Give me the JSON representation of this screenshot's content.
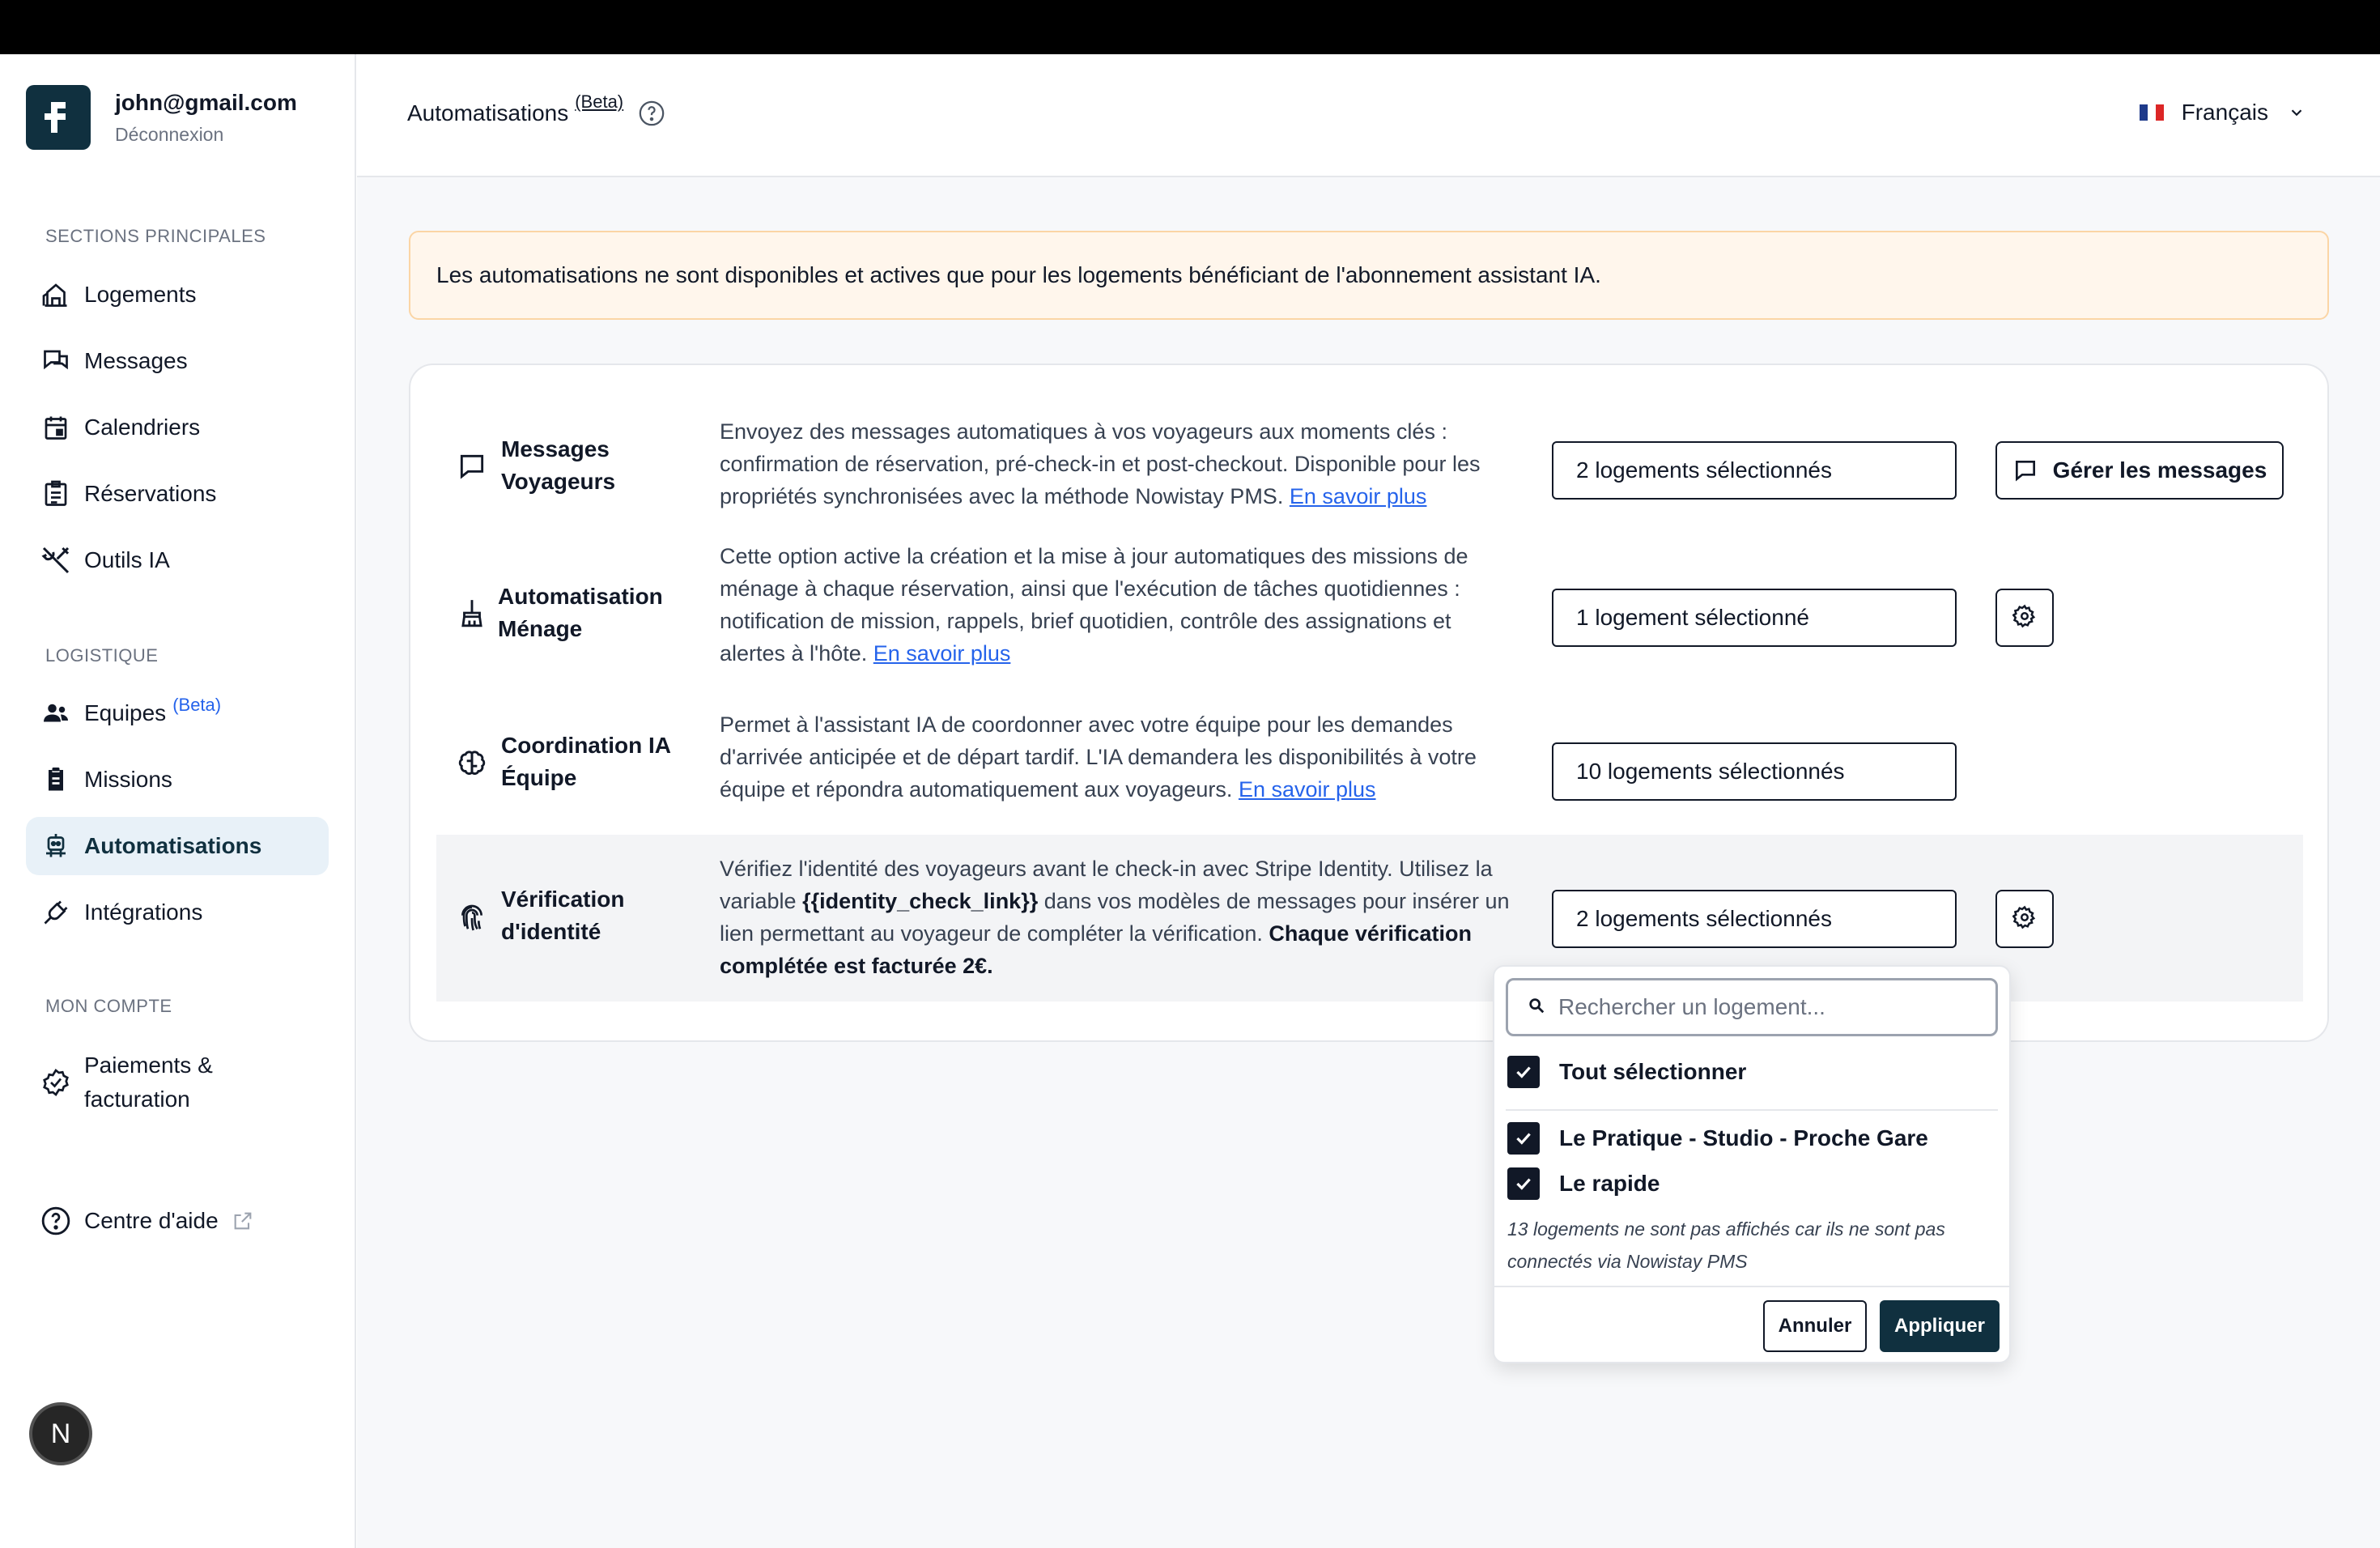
{
  "profile": {
    "email": "john@gmail.com",
    "logout_label": "Déconnexion",
    "logo_icon": "nowistay-logo-icon"
  },
  "sidebar": {
    "sections": [
      {
        "label": "SECTIONS PRINCIPALES",
        "items": [
          {
            "label": "Logements",
            "icon": "building-icon"
          },
          {
            "label": "Messages",
            "icon": "chat-bubbles-icon"
          },
          {
            "label": "Calendriers",
            "icon": "calendar-icon"
          },
          {
            "label": "Réservations",
            "icon": "clipboard-list-icon"
          },
          {
            "label": "Outils IA",
            "icon": "tools-icon"
          }
        ]
      },
      {
        "label": "LOGISTIQUE",
        "items": [
          {
            "label": "Equipes",
            "badge": "(Beta)",
            "icon": "team-icon"
          },
          {
            "label": "Missions",
            "icon": "clipboard-icon"
          },
          {
            "label": "Automatisations",
            "icon": "robot-icon",
            "active": true
          },
          {
            "label": "Intégrations",
            "icon": "plug-icon"
          }
        ]
      },
      {
        "label": "MON COMPTE",
        "items": [
          {
            "label": "Paiements & facturation",
            "icon": "badge-check-icon"
          },
          {
            "label": "Centre d'aide",
            "icon": "help-circle-icon",
            "external": true
          }
        ]
      }
    ],
    "bottom_badge": "N"
  },
  "header": {
    "title": "Automatisations",
    "title_badge": "(Beta)",
    "language": "Français"
  },
  "alert": {
    "text": "Les automatisations ne sont disponibles et actives que pour les logements bénéficiant de l'abonnement assistant IA."
  },
  "automations": [
    {
      "title": "Messages Voyageurs",
      "icon": "message-square-icon",
      "description": "Envoyez des messages automatiques à vos voyageurs aux moments clés : confirmation de réservation, pré-check-in et post-checkout. Disponible pour les propriétés synchronisées avec la méthode Nowistay PMS.",
      "link": "En savoir plus",
      "selection": "2 logements sélectionnés",
      "action_label": "Gérer les messages"
    },
    {
      "title": "Automatisation Ménage",
      "icon": "broom-icon",
      "description": "Cette option active la création et la mise à jour automatiques des missions de ménage à chaque réservation, ainsi que l'exécution de tâches quotidiennes : notification de mission, rappels, brief quotidien, contrôle des assignations et alertes à l'hôte.",
      "link": "En savoir plus",
      "selection": "1 logement sélectionné"
    },
    {
      "title": "Coordination IA Équipe",
      "icon": "brain-icon",
      "description": "Permet à l'assistant IA de coordonner avec votre équipe pour les demandes d'arrivée anticipée et de départ tardif. L'IA demandera les disponibilités à votre équipe et répondra automatiquement aux voyageurs.",
      "link": "En savoir plus",
      "selection": "10 logements sélectionnés"
    },
    {
      "title": "Vérification d'identité",
      "icon": "fingerprint-icon",
      "description_before": "Vérifiez l'identité des voyageurs avant le check-in avec Stripe Identity. Utilisez la variable",
      "description_variable": "{{identity_check_link}}",
      "description_after": "dans vos modèles de messages pour insérer un lien permettant au voyageur de compléter la vérification.",
      "description_bold": "Chaque vérification complétée est facturée 2€.",
      "selection": "2 logements sélectionnés"
    }
  ],
  "dropdown": {
    "search_placeholder": "Rechercher un logement...",
    "select_all": "Tout sélectionner",
    "options": [
      "Le Pratique - Studio - Proche Gare",
      "Le rapide"
    ],
    "note": "13 logements ne sont pas affichés car ils ne sont pas connectés via Nowistay PMS",
    "cancel_label": "Annuler",
    "apply_label": "Appliquer"
  },
  "colors": {
    "brand": "#10303f",
    "active_bg": "#e8f1f8",
    "link": "#2563eb",
    "alert_bg": "#fff6ec",
    "alert_border": "#fbd5a5"
  }
}
